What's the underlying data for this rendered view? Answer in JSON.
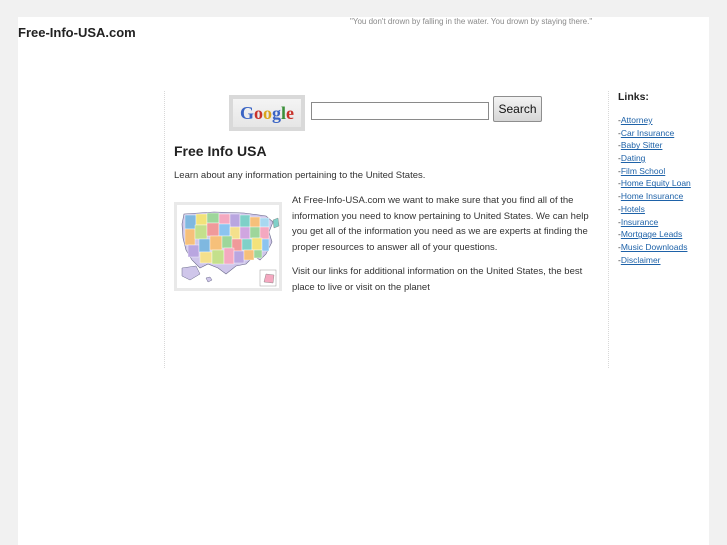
{
  "header": {
    "site_title": "Free-Info-USA.com",
    "quote": "\"You don't drown by falling in the water. You drown by staying there.\""
  },
  "search": {
    "logo_text": "Google",
    "logo_colors": [
      "#3a64c4",
      "#c8322a",
      "#d9a41b",
      "#3a64c4",
      "#3b8f3a",
      "#c8322a"
    ],
    "input_value": "",
    "button_label": "Search"
  },
  "main": {
    "heading": "Free Info USA",
    "intro": "Learn about any information pertaining to the United States.",
    "image": "usa-map",
    "paragraph1": "At Free-Info-USA.com we want to make sure that you find all of the information you need to know pertaining to United States.  We can help you get all of the information you need as we are experts at finding the proper resources to answer all of your questions.",
    "paragraph2": "Visit our links for additional information on the United States, the best place to live or visit on the planet"
  },
  "sidebar": {
    "heading": "Links:",
    "prefix": "-",
    "links": [
      {
        "label": "Attorney"
      },
      {
        "label": "Car Insurance"
      },
      {
        "label": "Baby Sitter"
      },
      {
        "label": "Dating"
      },
      {
        "label": "Film School"
      },
      {
        "label": "Home Equity Loan"
      },
      {
        "label": "Home Insurance"
      },
      {
        "label": "Hotels"
      },
      {
        "label": "Insurance"
      },
      {
        "label": "Mortgage Leads"
      },
      {
        "label": "Music Downloads"
      },
      {
        "label": "Disclaimer"
      }
    ]
  },
  "colors": {
    "background": "#f1f1f1",
    "link": "#1e62a8",
    "quote": "#8a8a8a"
  }
}
